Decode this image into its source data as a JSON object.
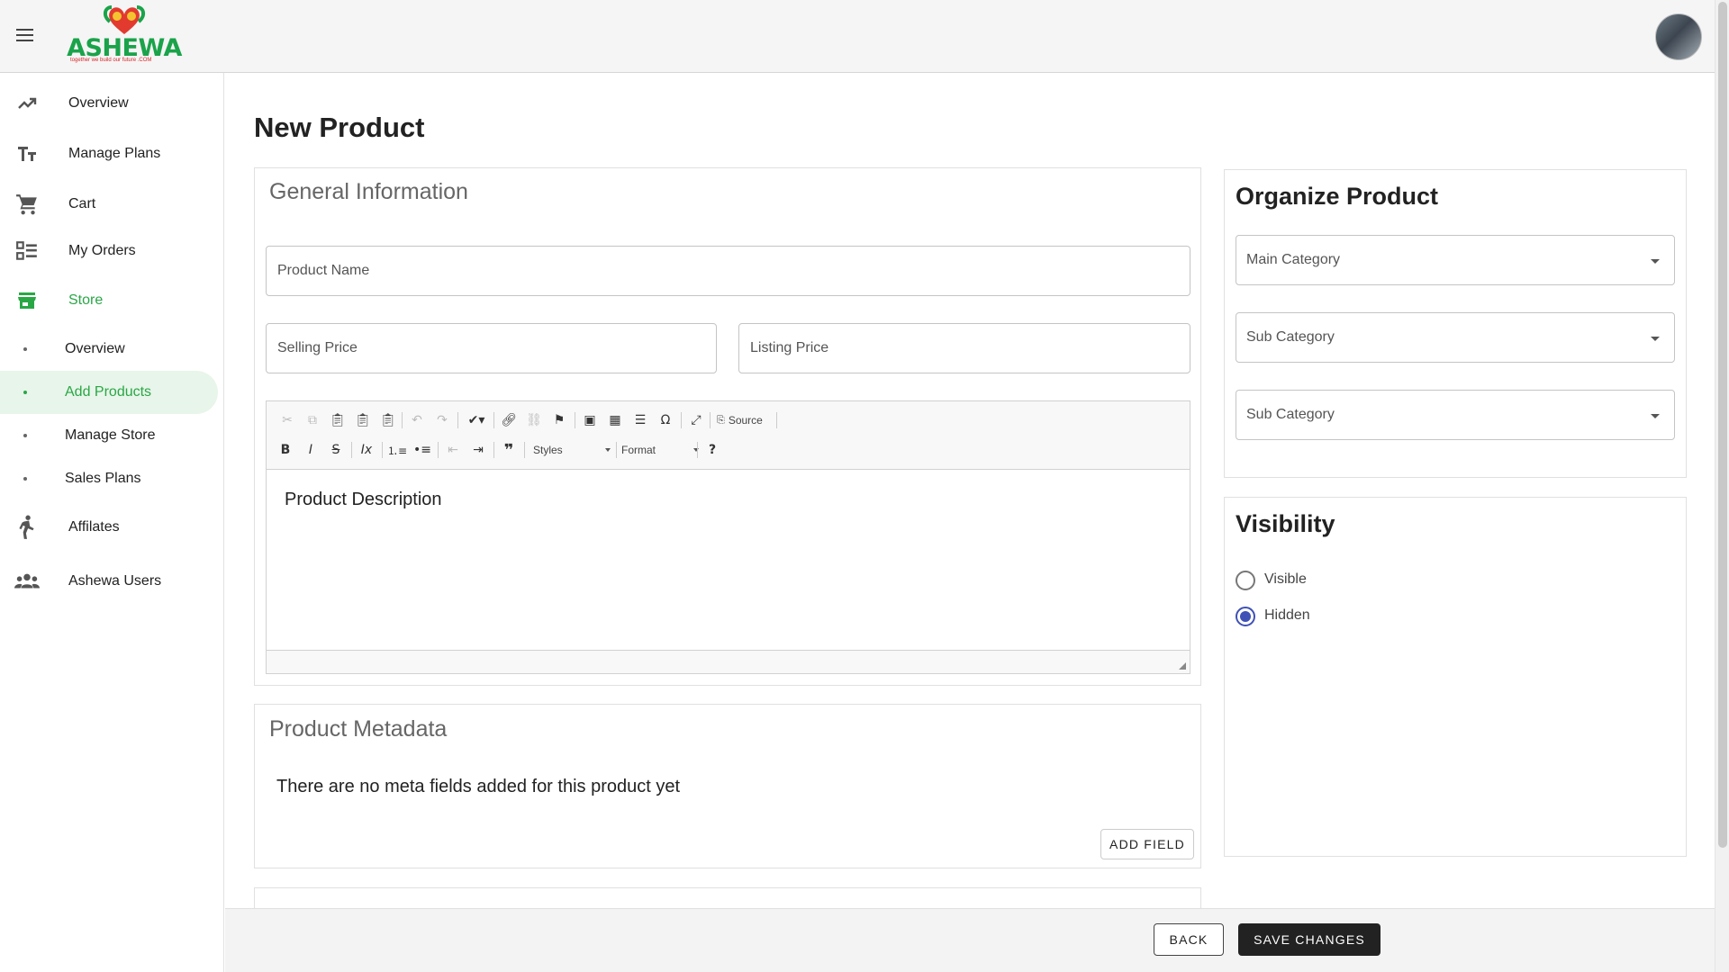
{
  "header": {
    "logo_text": "ASHEWA",
    "logo_sub": "together we build our future  .COM"
  },
  "sidebar": {
    "items": [
      {
        "label": "Overview",
        "icon": "trending-up-icon"
      },
      {
        "label": "Manage Plans",
        "icon": "text-format-icon"
      },
      {
        "label": "Cart",
        "icon": "cart-icon"
      },
      {
        "label": "My Orders",
        "icon": "checklist-icon"
      },
      {
        "label": "Store",
        "icon": "store-icon"
      }
    ],
    "store_sub": [
      {
        "label": "Overview"
      },
      {
        "label": "Add Products",
        "active": true
      },
      {
        "label": "Manage Store"
      },
      {
        "label": "Sales Plans"
      }
    ],
    "items_after": [
      {
        "label": "Affilates",
        "icon": "runner-icon"
      },
      {
        "label": "Ashewa Users",
        "icon": "people-icon"
      }
    ]
  },
  "page": {
    "title": "New Product"
  },
  "general": {
    "title": "General Information",
    "product_name_placeholder": "Product Name",
    "selling_price_placeholder": "Selling Price",
    "listing_price_placeholder": "Listing Price",
    "description_placeholder": "Product Description"
  },
  "editor": {
    "source_label": "Source",
    "styles_label": "Styles",
    "format_label": "Format"
  },
  "metadata": {
    "title": "Product Metadata",
    "empty_text": "There are no meta fields added for this product yet",
    "add_field_label": "ADD FIELD"
  },
  "organize": {
    "title": "Organize Product",
    "main_category": "Main Category",
    "sub_category_1": "Sub Category",
    "sub_category_2": "Sub Category"
  },
  "visibility": {
    "title": "Visibility",
    "options": [
      {
        "label": "Visible",
        "checked": false
      },
      {
        "label": "Hidden",
        "checked": true
      }
    ]
  },
  "actions": {
    "back_label": "BACK",
    "save_label": "SAVE CHANGES"
  },
  "colors": {
    "accent_green": "#29a745",
    "radio_blue": "#3f51b5",
    "dark_button": "#222222"
  }
}
